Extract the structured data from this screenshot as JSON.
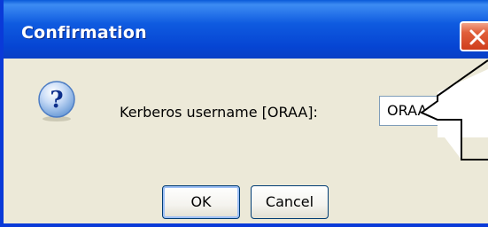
{
  "window": {
    "title": "Confirmation",
    "close_label": "Close"
  },
  "dialog": {
    "icon": "question-icon",
    "prompt": "Kerberos username [ORAA]:",
    "input_value": "ORAA",
    "ok_label": "OK",
    "cancel_label": "Cancel"
  },
  "colors": {
    "titlebar": "#0a5ad8",
    "dialog_bg": "#ece9d8",
    "close_button": "#e1603b"
  }
}
